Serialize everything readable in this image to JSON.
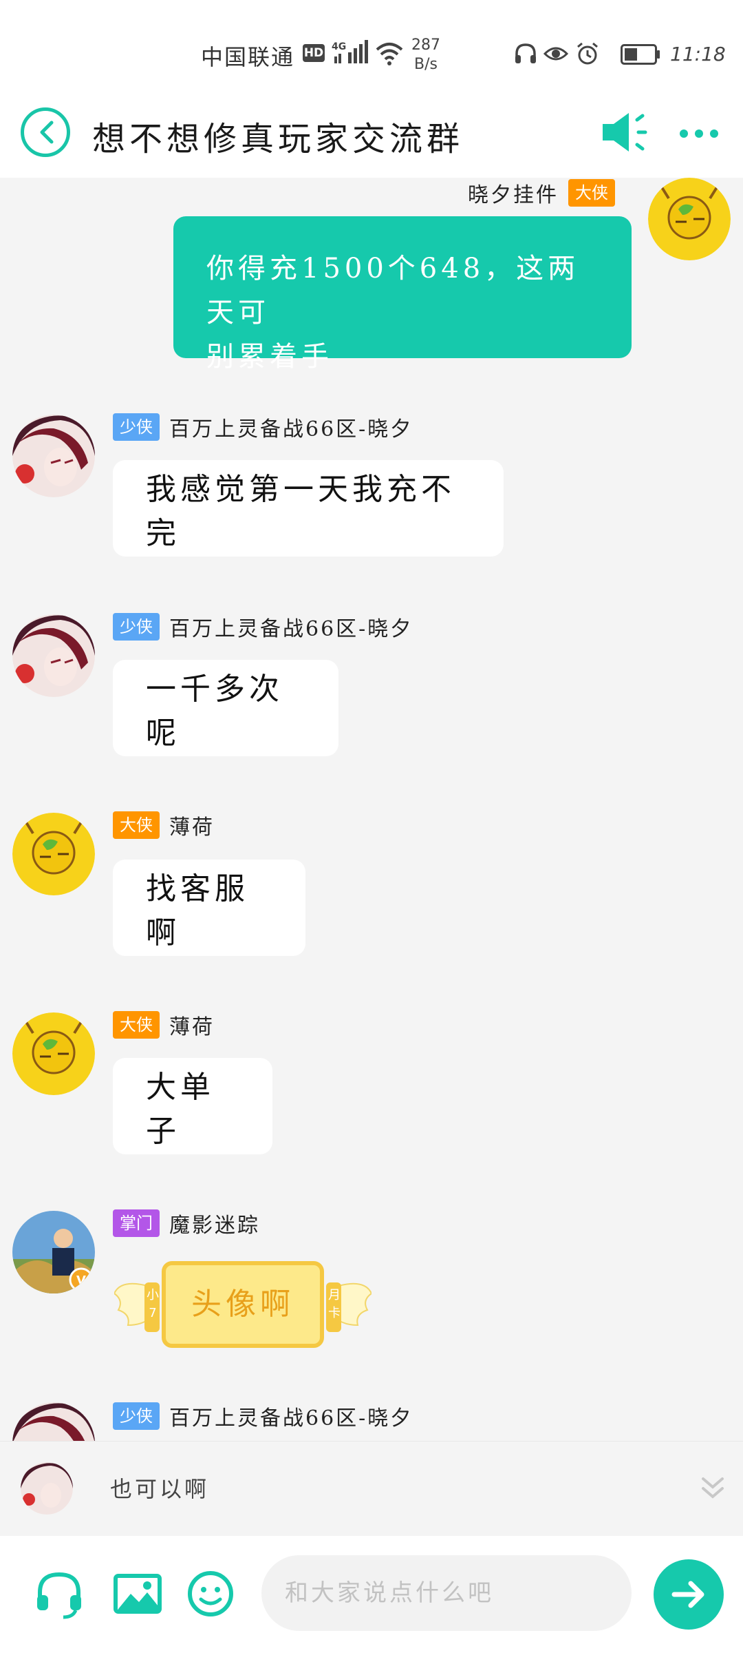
{
  "status_bar": {
    "carrier": "中国联通",
    "hd": "HD",
    "network": "4G",
    "speed_value": "287",
    "speed_unit": "B/s",
    "time": "11:18"
  },
  "header": {
    "title": "想不想修真玩家交流群"
  },
  "messages": [
    {
      "sender": "晓夕挂件",
      "rank": "大侠",
      "text_line1": "你得充1500个648，这两天可",
      "text_line2": "别累着手"
    },
    {
      "sender": "百万上灵备战66区-晓夕",
      "rank": "少侠",
      "text": "我感觉第一天我充不完"
    },
    {
      "sender": "百万上灵备战66区-晓夕",
      "rank": "少侠",
      "text": "一千多次呢"
    },
    {
      "sender": "薄荷",
      "rank": "大侠",
      "text": "找客服啊"
    },
    {
      "sender": "薄荷",
      "rank": "大侠",
      "text": "大单子"
    },
    {
      "sender": "魔影迷踪",
      "rank": "掌门",
      "text": "头像啊",
      "card_left": "小7",
      "card_right": "月卡"
    },
    {
      "sender": "百万上灵备战66区-晓夕",
      "rank": "少侠"
    }
  ],
  "mini_bar": {
    "text": "也可以啊"
  },
  "input": {
    "placeholder": "和大家说点什么吧"
  },
  "colors": {
    "accent": "#16c9ac",
    "badge_shaoxia": "#5aa6f5",
    "badge_daxia": "#ff9500",
    "badge_zhangmen": "#b356e8"
  }
}
